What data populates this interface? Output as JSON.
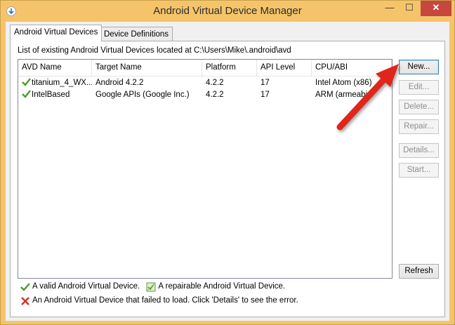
{
  "window": {
    "title": "Android Virtual Device Manager",
    "minimize_glyph": "—",
    "maximize_glyph": "☐",
    "close_glyph": "✕"
  },
  "tabs": [
    {
      "label": "Android Virtual Devices",
      "active": true
    },
    {
      "label": "Device Definitions",
      "active": false
    }
  ],
  "list_caption": "List of existing Android Virtual Devices located at C:\\Users\\Mike\\.android\\avd",
  "table": {
    "columns": [
      "AVD Name",
      "Target Name",
      "Platform",
      "API Level",
      "CPU/ABI"
    ],
    "rows": [
      {
        "name": "titanium_4_WX...",
        "target": "Android 4.2.2",
        "platform": "4.2.2",
        "api": "17",
        "cpu": "Intel Atom (x86)",
        "status": "valid"
      },
      {
        "name": "IntelBased",
        "target": "Google APIs (Google Inc.)",
        "platform": "4.2.2",
        "api": "17",
        "cpu": "ARM (armeabi-v",
        "status": "valid"
      }
    ]
  },
  "buttons": {
    "new": "New...",
    "edit": "Edit...",
    "delete": "Delete...",
    "repair": "Repair...",
    "details": "Details...",
    "start": "Start...",
    "refresh": "Refresh"
  },
  "legend": {
    "valid": "A valid Android Virtual Device.",
    "repairable": "A repairable Android Virtual Device.",
    "failed": "An Android Virtual Device that failed to load. Click 'Details' to see the error."
  },
  "colors": {
    "title_bar": "#f5c46a",
    "close_button": "#c7463d",
    "valid_check": "#4c9a2a",
    "error_x": "#d9342b",
    "annotation_arrow": "#e0261f"
  }
}
